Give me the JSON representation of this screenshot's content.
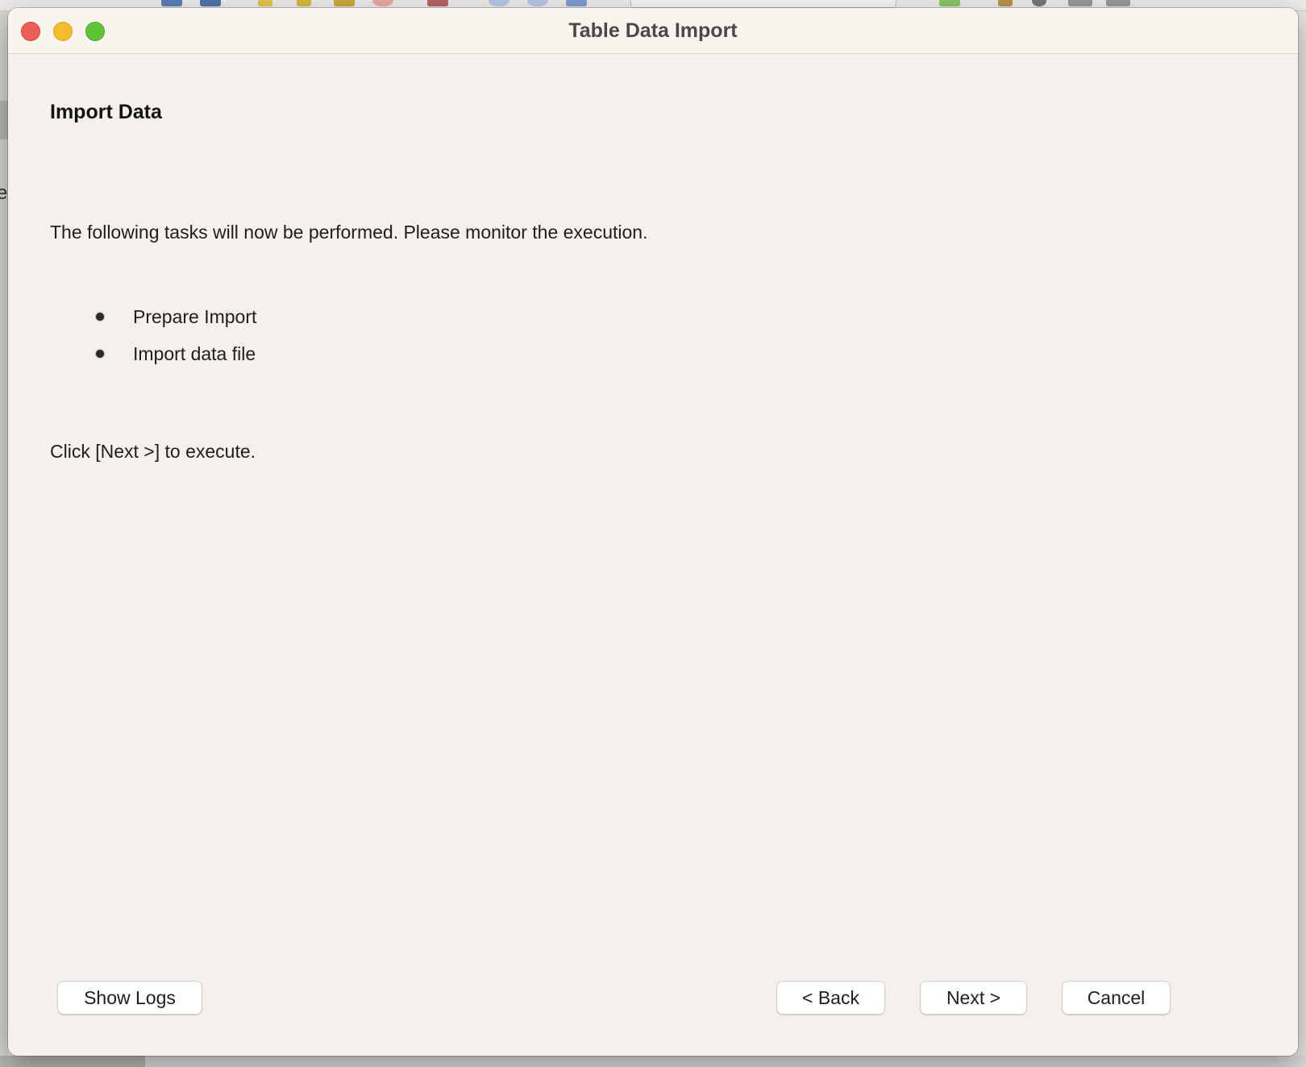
{
  "background": {
    "toolbar_dropdown_label": "",
    "left_letter": "e"
  },
  "window": {
    "title": "Table Data Import"
  },
  "content": {
    "heading": "Import Data",
    "intro": "The following tasks will now be performed. Please monitor the execution.",
    "tasks": [
      {
        "label": "Prepare Import"
      },
      {
        "label": "Import data file"
      }
    ],
    "hint": "Click [Next >] to execute."
  },
  "buttons": {
    "show_logs": "Show Logs",
    "back": "< Back",
    "next": "Next >",
    "cancel": "Cancel"
  },
  "colors": {
    "dialog_bg": "#f4f0eb",
    "close": "#ec5f56",
    "minimize": "#f4bc2f",
    "maximize": "#5fc43a"
  }
}
